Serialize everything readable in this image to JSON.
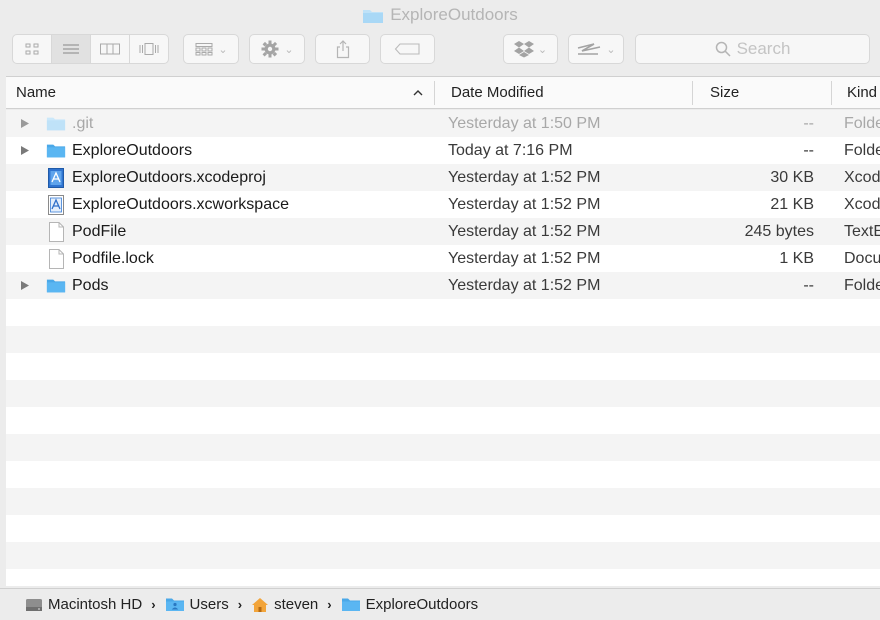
{
  "window": {
    "title": "ExploreOutdoors"
  },
  "toolbar": {
    "search_placeholder": "Search"
  },
  "columns": {
    "name": "Name",
    "date": "Date Modified",
    "size": "Size",
    "kind": "Kind"
  },
  "files": [
    {
      "name": ".git",
      "date": "Yesterday at 1:50 PM",
      "size": "--",
      "kind": "Folder",
      "icon": "folder-icon",
      "expandable": true,
      "dimmed": true
    },
    {
      "name": "ExploreOutdoors",
      "date": "Today at 7:16 PM",
      "size": "--",
      "kind": "Folder",
      "icon": "folder-icon",
      "expandable": true,
      "dimmed": false
    },
    {
      "name": "ExploreOutdoors.xcodeproj",
      "date": "Yesterday at 1:52 PM",
      "size": "30 KB",
      "kind": "Xcode",
      "icon": "xcodeproj-icon",
      "expandable": false,
      "dimmed": false
    },
    {
      "name": "ExploreOutdoors.xcworkspace",
      "date": "Yesterday at 1:52 PM",
      "size": "21 KB",
      "kind": "Xcode",
      "icon": "xcworkspace-icon",
      "expandable": false,
      "dimmed": false
    },
    {
      "name": "PodFile",
      "date": "Yesterday at 1:52 PM",
      "size": "245 bytes",
      "kind": "TextE",
      "icon": "document-icon",
      "expandable": false,
      "dimmed": false
    },
    {
      "name": "Podfile.lock",
      "date": "Yesterday at 1:52 PM",
      "size": "1 KB",
      "kind": "Docu",
      "icon": "document-icon",
      "expandable": false,
      "dimmed": false
    },
    {
      "name": "Pods",
      "date": "Yesterday at 1:52 PM",
      "size": "--",
      "kind": "Folder",
      "icon": "folder-icon",
      "expandable": true,
      "dimmed": false
    }
  ],
  "path": [
    {
      "label": "Macintosh HD",
      "icon": "hard-drive-icon"
    },
    {
      "label": "Users",
      "icon": "users-folder-icon"
    },
    {
      "label": "steven",
      "icon": "home-icon"
    },
    {
      "label": "ExploreOutdoors",
      "icon": "folder-icon"
    }
  ],
  "colors": {
    "folder": "#5ab6f2",
    "folder_dim": "#bfe2f8",
    "stripe": "#f4f4f4",
    "dim_text": "#a8a8a8"
  }
}
